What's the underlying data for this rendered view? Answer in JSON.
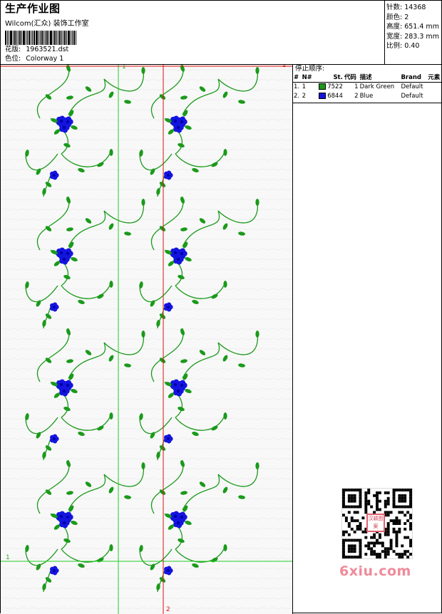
{
  "header": {
    "title": "生产作业图",
    "company": "Wilcom(汇众)&#32;装饰工作室",
    "design_label": "花版:",
    "design_value": "1963521.dst",
    "colorway_label": "色位:",
    "colorway_value": "Colorway 1"
  },
  "stats": {
    "stitches": "针数: 14368",
    "colors": "颜色: 2",
    "height": "高度: 651.4 mm",
    "width": "宽度: 283.3 mm",
    "scale": "比例: 0.40"
  },
  "stop_sequence": {
    "title": "停止顺序:",
    "columns": [
      "#",
      "N#",
      "St.",
      "代码",
      "描述",
      "Brand",
      "元素"
    ],
    "rows": [
      {
        "idx": "1.",
        "n": "1",
        "color": "#1a9a1a",
        "st": "7522",
        "code": "1",
        "desc": "Dark Green",
        "brand": "Default",
        "elem": ""
      },
      {
        "idx": "2.",
        "n": "2",
        "color": "#1414e0",
        "st": "6844",
        "code": "2",
        "desc": "Blue",
        "brand": "Default",
        "elem": ""
      }
    ]
  },
  "markers": {
    "top_green": "1",
    "top_red": "2",
    "left_green": "1",
    "bottom_red": "2"
  },
  "colors": {
    "leaf": "#1a9a1a",
    "flower": "#1414e0",
    "guide_green": "#22cc22",
    "guide_red": "#dd1111"
  },
  "watermark": {
    "text": "6xiu.com",
    "badge": "汉颖图案"
  }
}
